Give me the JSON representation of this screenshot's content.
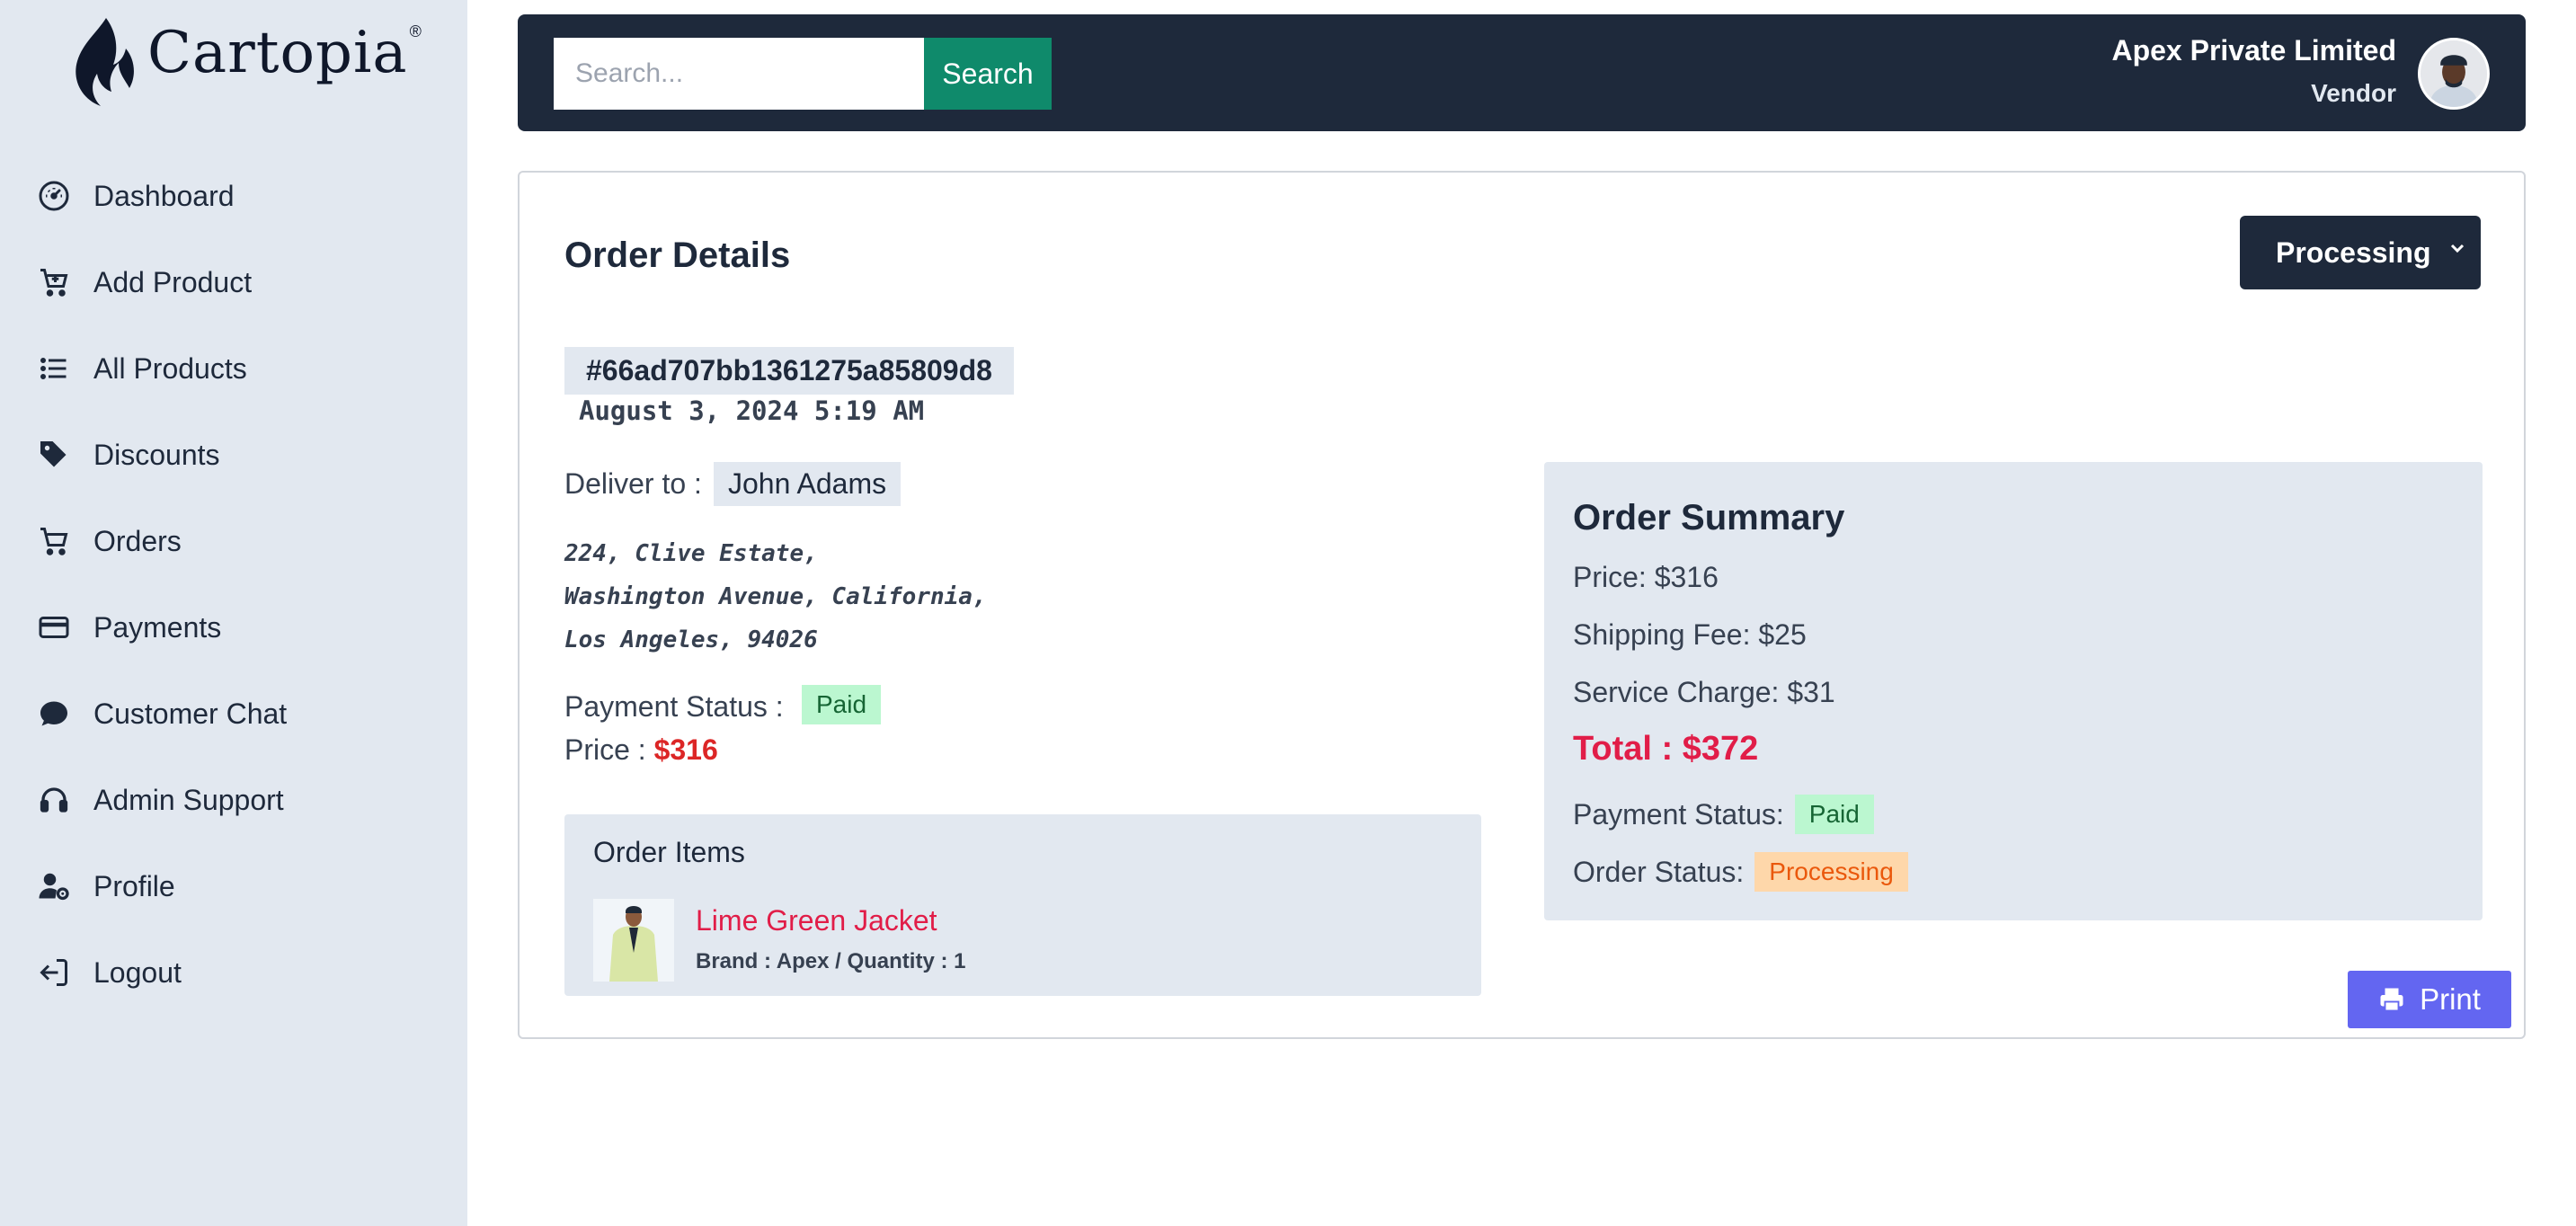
{
  "brand": {
    "name": "Cartopia",
    "reg_mark": "®"
  },
  "sidebar": {
    "items": [
      {
        "label": "Dashboard",
        "icon": "gauge-icon"
      },
      {
        "label": "Add Product",
        "icon": "cart-plus-icon"
      },
      {
        "label": "All Products",
        "icon": "list-icon"
      },
      {
        "label": "Discounts",
        "icon": "tags-icon"
      },
      {
        "label": "Orders",
        "icon": "cart-icon"
      },
      {
        "label": "Payments",
        "icon": "credit-card-icon"
      },
      {
        "label": "Customer Chat",
        "icon": "chat-icon"
      },
      {
        "label": "Admin Support",
        "icon": "headset-icon"
      },
      {
        "label": "Profile",
        "icon": "user-gear-icon"
      },
      {
        "label": "Logout",
        "icon": "logout-icon"
      }
    ]
  },
  "header": {
    "search_placeholder": "Search...",
    "search_label": "Search",
    "vendor_name": "Apex Private Limited",
    "vendor_role": "Vendor"
  },
  "order": {
    "title": "Order Details",
    "status_select": "Processing",
    "id": "#66ad707bb1361275a85809d8",
    "date": "August 3, 2024 5:19 AM",
    "deliver_label": "Deliver to :",
    "deliver_name": "John Adams",
    "address_lines": [
      "224, Clive Estate,",
      "Washington Avenue, California,",
      "Los Angeles, 94026"
    ],
    "payment_status_label": "Payment Status :",
    "payment_status": "Paid",
    "price_label": "Price :",
    "price": "$316"
  },
  "items": {
    "title": "Order Items",
    "list": [
      {
        "name": "Lime Green Jacket",
        "meta": "Brand : Apex / Quantity : 1"
      }
    ]
  },
  "summary": {
    "title": "Order Summary",
    "price": "Price: $316",
    "shipping": "Shipping Fee: $25",
    "service": "Service Charge: $31",
    "total": "Total : $372",
    "payment_label": "Payment Status:",
    "payment_status": "Paid",
    "order_label": "Order Status:",
    "order_status": "Processing"
  },
  "print_label": "Print",
  "colors": {
    "sidebar_bg": "#e2e8f0",
    "header_bg": "#1e293b",
    "search_btn": "#0f8a6b",
    "accent_red": "#e11d48",
    "print_btn": "#6366f1",
    "paid_badge": "#bbf7d0",
    "processing_badge": "#fed7aa"
  }
}
